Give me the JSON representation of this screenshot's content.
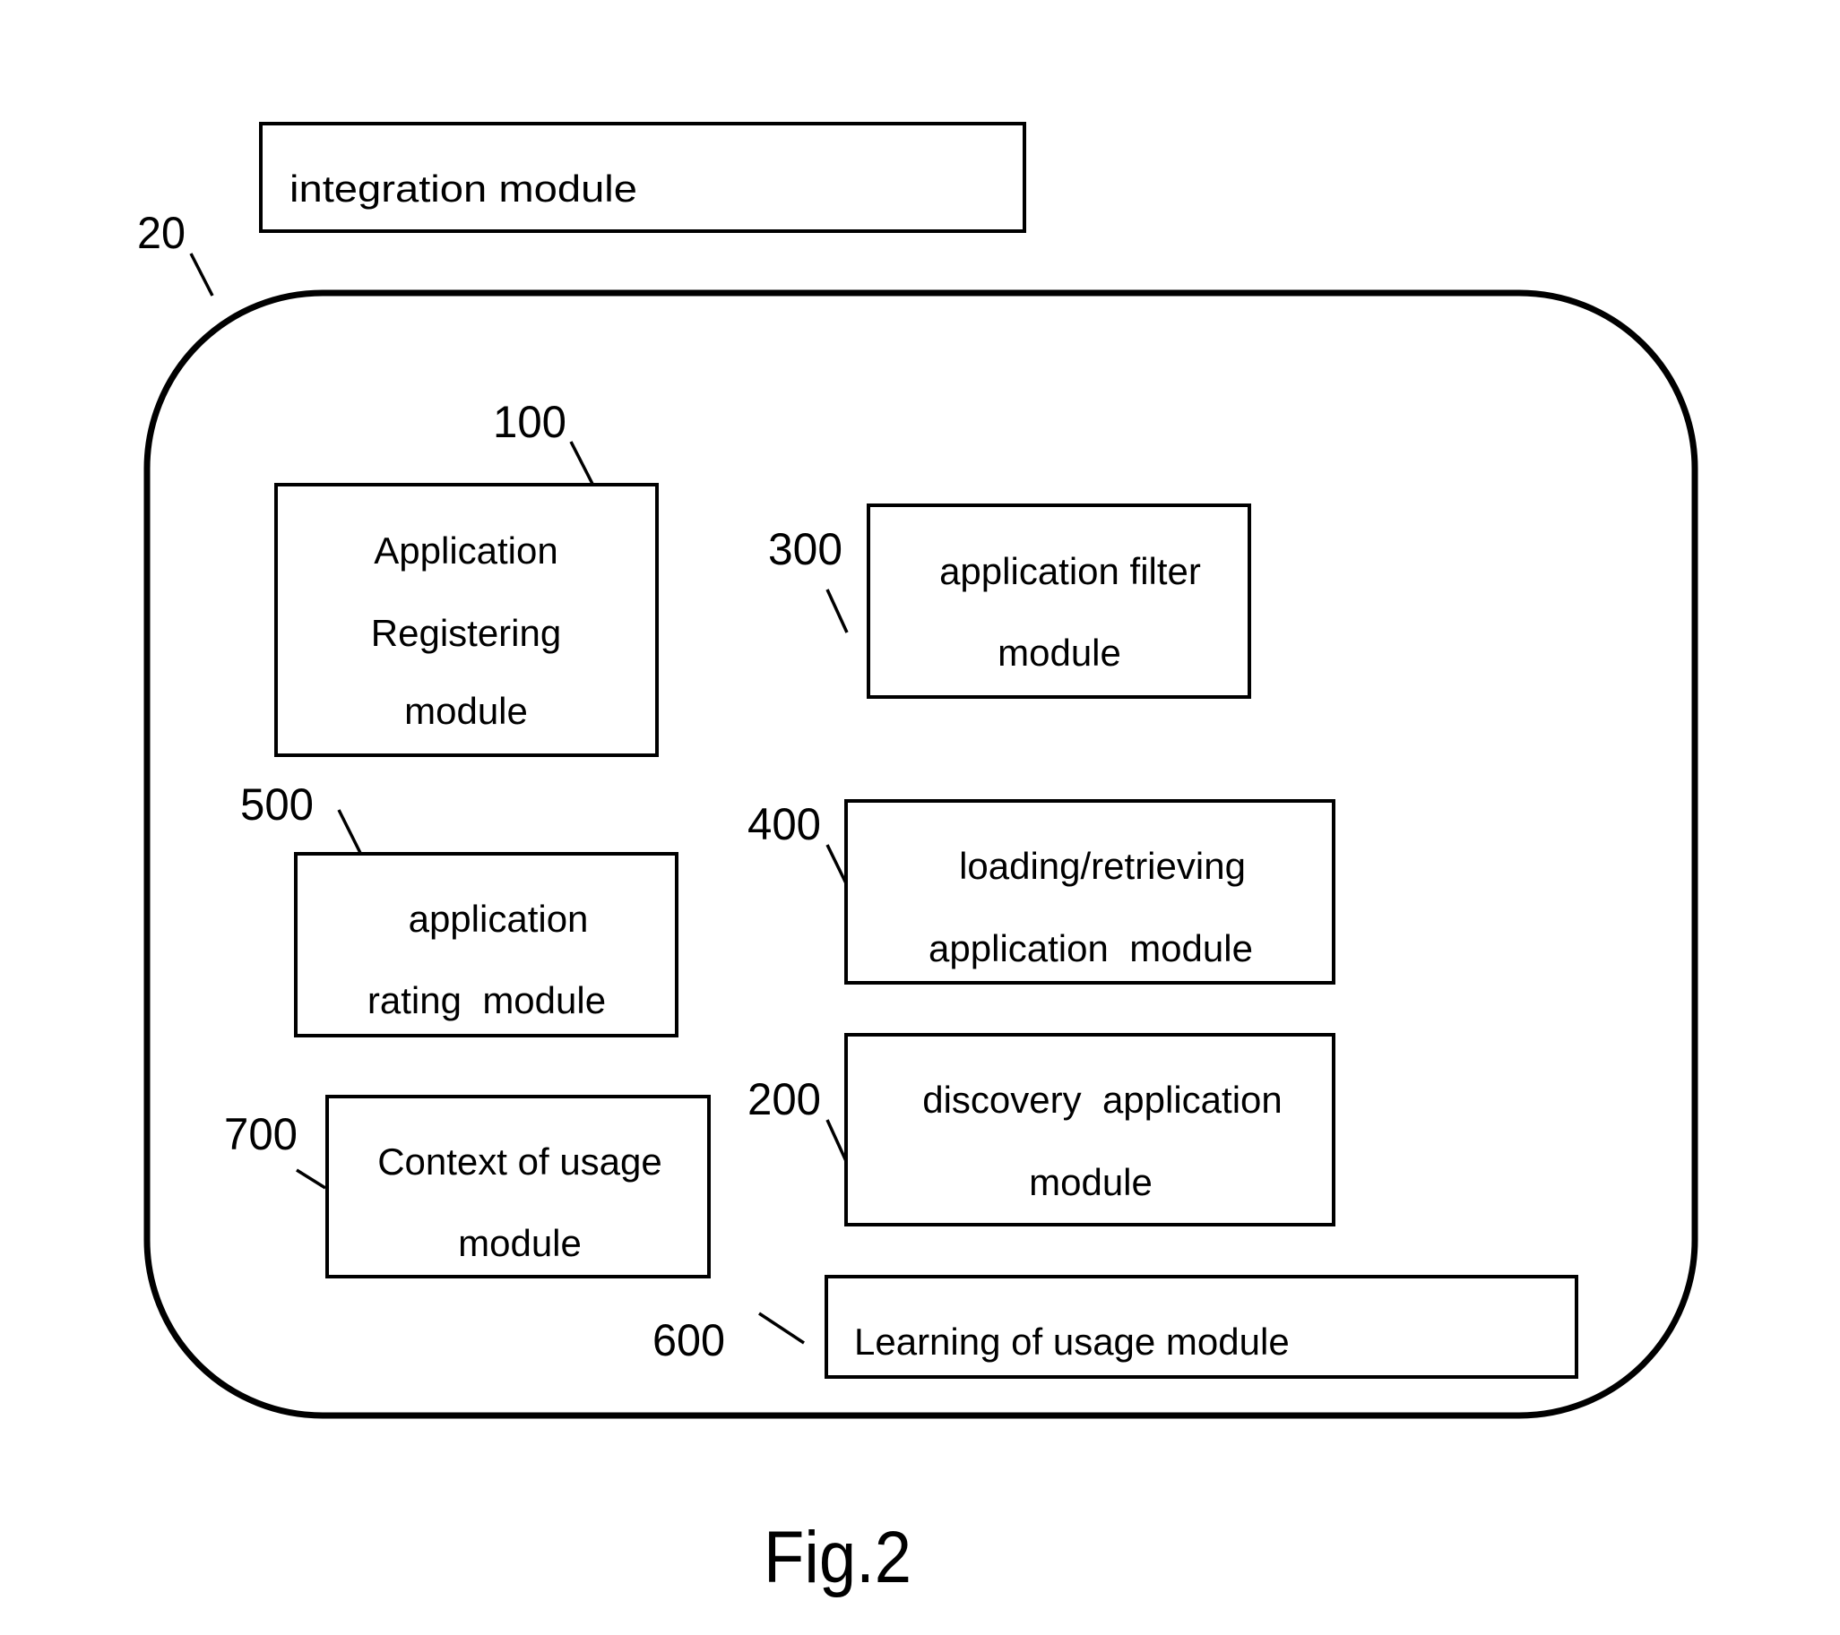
{
  "figure": {
    "caption": "Fig.2",
    "system_ref": "20"
  },
  "integration_module": {
    "label": "integration module"
  },
  "modules": {
    "m100": {
      "ref": "100",
      "lines": [
        "Application",
        "Registering",
        "module"
      ]
    },
    "m300": {
      "ref": "300",
      "lines": [
        "application filter",
        "module"
      ]
    },
    "m500": {
      "ref": "500",
      "lines": [
        "application",
        "rating  module"
      ]
    },
    "m400": {
      "ref": "400",
      "lines": [
        "loading/retrieving",
        "application  module"
      ]
    },
    "m700": {
      "ref": "700",
      "lines": [
        "Context of usage",
        "module"
      ]
    },
    "m200": {
      "ref": "200",
      "lines": [
        "discovery  application",
        "module"
      ]
    },
    "m600": {
      "ref": "600",
      "lines": [
        "Learning of usage module"
      ]
    }
  }
}
